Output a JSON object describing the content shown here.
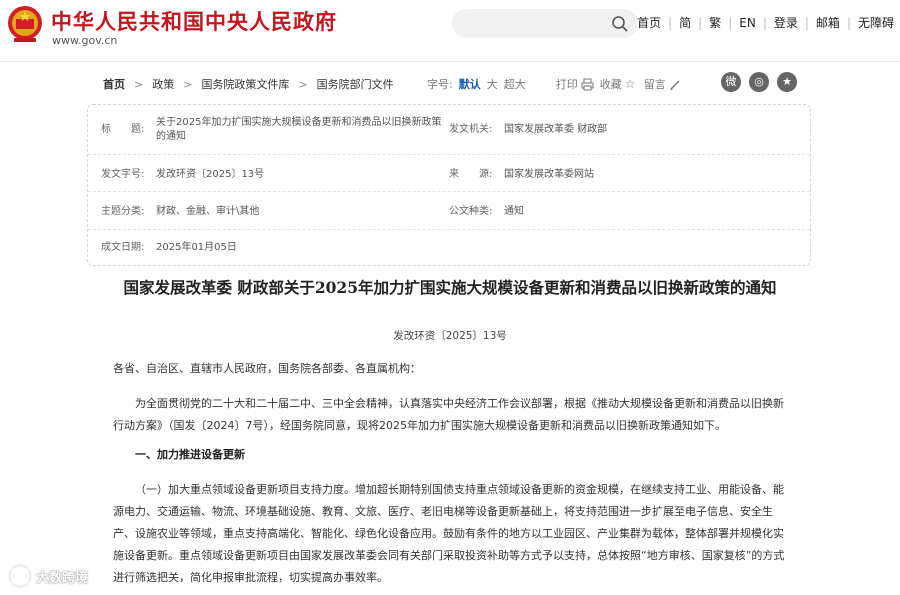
{
  "header": {
    "site_title": "中华人民共和国中央人民政府",
    "site_url": "www.gov.cn",
    "search_placeholder": "",
    "links": [
      "首页",
      "简",
      "繁",
      "EN",
      "登录",
      "邮箱",
      "无障碍"
    ],
    "brand_color": "#c4161c"
  },
  "breadcrumb": {
    "items": [
      "首页",
      "政策",
      "国务院政策文件库",
      "国务院部门文件"
    ]
  },
  "tools": {
    "font_size_label": "字号:",
    "font_default": "默认",
    "font_large": "大",
    "font_xlarge": "超大",
    "print": "打印",
    "favorite": "收藏",
    "comment": "留言",
    "share_icons": [
      "weibo-icon",
      "wechat-icon",
      "favorite-star-icon"
    ]
  },
  "meta": {
    "title_label": "标　　题:",
    "title_value": "关于2025年加力扩围实施大规模设备更新和消费品以旧换新政策的通知",
    "issuer_label": "发文机关:",
    "issuer_value": "国家发展改革委 财政部",
    "doc_no_label": "发文字号:",
    "doc_no_value": "发改环资〔2025〕13号",
    "source_label": "来　　源:",
    "source_value": "国家发展改革委网站",
    "topic_label": "主题分类:",
    "topic_value": "财政、金融、审计\\其他",
    "type_label": "公文种类:",
    "type_value": "通知",
    "date_label": "成文日期:",
    "date_value": "2025年01月05日"
  },
  "document": {
    "title": "国家发展改革委 财政部关于2025年加力扩围实施大规模设备更新和消费品以旧换新政策的通知",
    "number": "发改环资〔2025〕13号",
    "salutation": "各省、自治区、直辖市人民政府，国务院各部委、各直属机构：",
    "intro": "为全面贯彻党的二十大和二十届二中、三中全会精神，认真落实中央经济工作会议部署，根据《推动大规模设备更新和消费品以旧换新行动方案》（国发〔2024〕7号），经国务院同意，现将2025年加力扩围实施大规模设备更新和消费品以旧换新政策通知如下。",
    "section1": "一、加力推进设备更新",
    "item1": "（一）加大重点领域设备更新项目支持力度。增加超长期特别国债支持重点领域设备更新的资金规模，在继续支持工业、用能设备、能源电力、交通运输、物流、环境基础设施、教育、文旅、医疗、老旧电梯等设备更新基础上，将支持范围进一步扩展至电子信息、安全生产、设施农业等领域，重点支持高端化、智能化、绿色化设备应用。鼓励有条件的地方以工业园区、产业集群为载体，整体部署并规模化实施设备更新。重点领域设备更新项目由国家发展改革委会同有关部门采取投资补助等方式予以支持，总体按照“地方审核、国家复核”的方式进行筛选把关，简化申报审批流程，切实提高办事效率。"
  },
  "watermark": "大数跨境"
}
